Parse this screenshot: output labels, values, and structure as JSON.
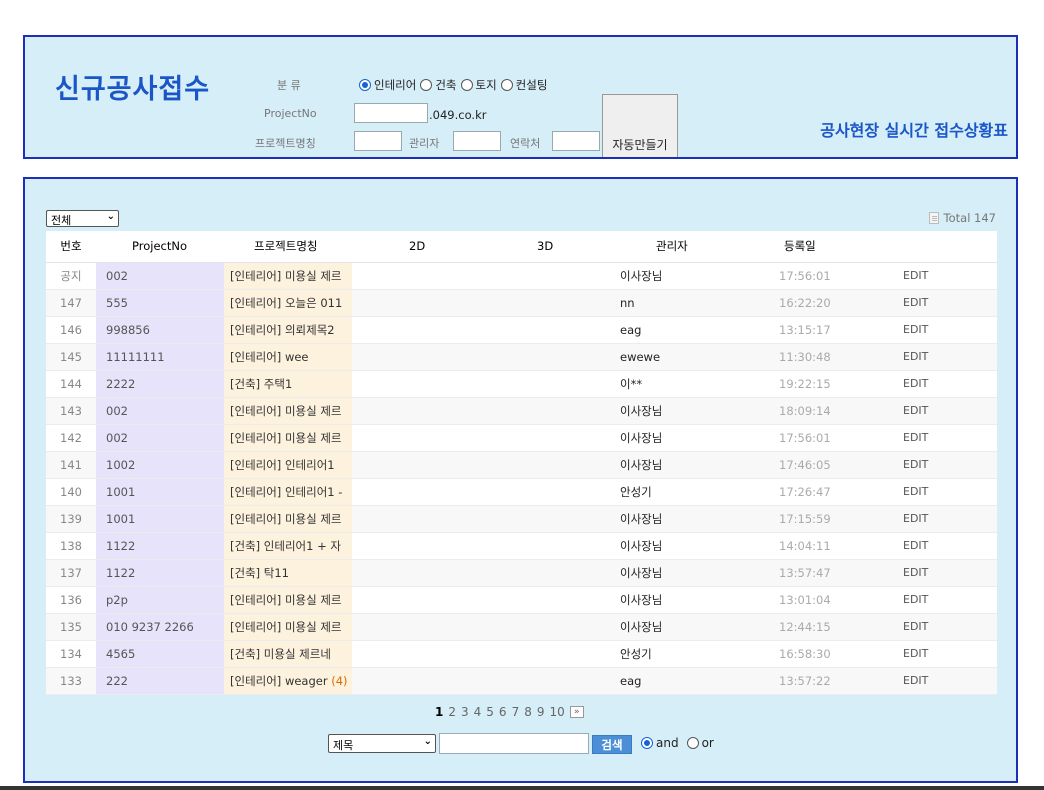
{
  "form": {
    "title": "신규공사접수",
    "category_label": "분 류",
    "category_options": [
      "인테리어",
      "건축",
      "토지",
      "컨설팅"
    ],
    "category_selected": "인테리어",
    "projectno_label": "ProjectNo",
    "projectno_value": "",
    "domain_suffix": ".049.co.kr",
    "project_name_label": "프로젝트명칭",
    "manager_label": "관리자",
    "contact_label": "연락처",
    "autogen_button": "자동만들기",
    "status_title": "공사현장 실시간 접수상황표"
  },
  "list": {
    "filter_selected": "전체",
    "total_label": "Total 147",
    "columns": [
      "번호",
      "ProjectNo",
      "프로젝트명칭",
      "2D",
      "3D",
      "관리자",
      "등록일",
      ""
    ],
    "rows": [
      {
        "no": "공지",
        "pid": "002",
        "name": "[인테리어] 미용실 제르",
        "comments": "",
        "mgr": "이사장님",
        "date": "17:56:01",
        "edit": "EDIT"
      },
      {
        "no": "147",
        "pid": "555",
        "name": "[인테리어] 오늘은 011",
        "comments": "",
        "mgr": "nn",
        "date": "16:22:20",
        "edit": "EDIT"
      },
      {
        "no": "146",
        "pid": "998856",
        "name": "[인테리어] 의뢰제목2",
        "comments": "",
        "mgr": "eag",
        "date": "13:15:17",
        "edit": "EDIT"
      },
      {
        "no": "145",
        "pid": "11111111",
        "name": "[인테리어] wee",
        "comments": "",
        "mgr": "ewewe",
        "date": "11:30:48",
        "edit": "EDIT"
      },
      {
        "no": "144",
        "pid": "2222",
        "name": "[건축] 주택1",
        "comments": "",
        "mgr": "이**",
        "date": "19:22:15",
        "edit": "EDIT"
      },
      {
        "no": "143",
        "pid": "002",
        "name": "[인테리어] 미용실 제르",
        "comments": "",
        "mgr": "이사장님",
        "date": "18:09:14",
        "edit": "EDIT"
      },
      {
        "no": "142",
        "pid": "002",
        "name": "[인테리어] 미용실 제르",
        "comments": "",
        "mgr": "이사장님",
        "date": "17:56:01",
        "edit": "EDIT"
      },
      {
        "no": "141",
        "pid": "1002",
        "name": "[인테리어] 인테리어1",
        "comments": "",
        "mgr": "이사장님",
        "date": "17:46:05",
        "edit": "EDIT"
      },
      {
        "no": "140",
        "pid": "1001",
        "name": "[인테리어] 인테리어1 -",
        "comments": "",
        "mgr": "안성기",
        "date": "17:26:47",
        "edit": "EDIT"
      },
      {
        "no": "139",
        "pid": "1001",
        "name": "[인테리어] 미용실 제르",
        "comments": "",
        "mgr": "이사장님",
        "date": "17:15:59",
        "edit": "EDIT"
      },
      {
        "no": "138",
        "pid": "1122",
        "name": "[건축] 인테리어1 + 자",
        "comments": "",
        "mgr": "이사장님",
        "date": "14:04:11",
        "edit": "EDIT"
      },
      {
        "no": "137",
        "pid": "1122",
        "name": "[건축] 탁11",
        "comments": "",
        "mgr": "이사장님",
        "date": "13:57:47",
        "edit": "EDIT"
      },
      {
        "no": "136",
        "pid": "p2p",
        "name": "[인테리어] 미용실 제르",
        "comments": "",
        "mgr": "이사장님",
        "date": "13:01:04",
        "edit": "EDIT"
      },
      {
        "no": "135",
        "pid": "010 9237 2266",
        "name": "[인테리어] 미용실 제르",
        "comments": "",
        "mgr": "이사장님",
        "date": "12:44:15",
        "edit": "EDIT"
      },
      {
        "no": "134",
        "pid": "4565",
        "name": "[건축] 미용실 제르네",
        "comments": "",
        "mgr": "안성기",
        "date": "16:58:30",
        "edit": "EDIT"
      },
      {
        "no": "133",
        "pid": "222",
        "name": "[인테리어] weager",
        "comments": "(4)",
        "mgr": "eag",
        "date": "13:57:22",
        "edit": "EDIT"
      }
    ]
  },
  "pagination": {
    "pages": [
      "1",
      "2",
      "3",
      "4",
      "5",
      "6",
      "7",
      "8",
      "9",
      "10"
    ],
    "current": "1",
    "next_label": "»"
  },
  "search": {
    "field_selected": "제목",
    "query": "",
    "button_label": "검색",
    "and_label": "and",
    "or_label": "or",
    "mode_selected": "and"
  }
}
